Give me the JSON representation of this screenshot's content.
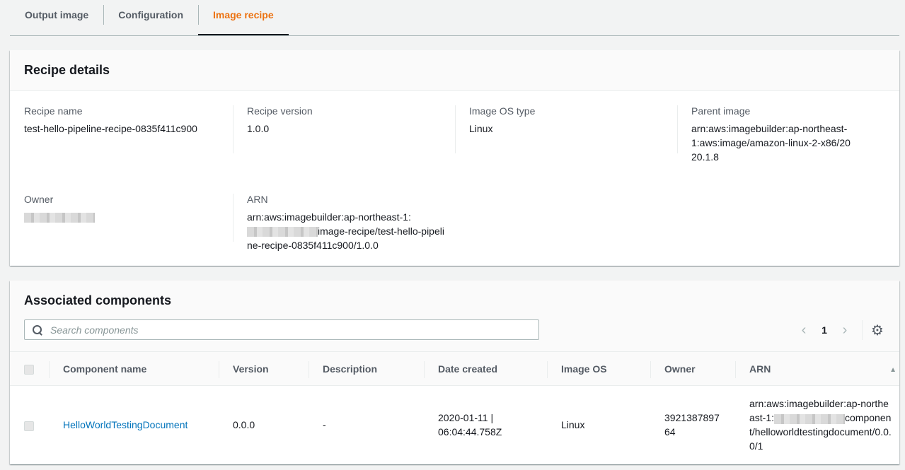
{
  "tabs": [
    {
      "label": "Output image",
      "active": false
    },
    {
      "label": "Configuration",
      "active": false
    },
    {
      "label": "Image recipe",
      "active": true
    }
  ],
  "colors": {
    "accent": "#ec7211",
    "link": "#0073bb"
  },
  "recipe_details": {
    "title": "Recipe details",
    "recipe_name": {
      "label": "Recipe name",
      "value": "test-hello-pipeline-recipe-0835f411c900"
    },
    "recipe_version": {
      "label": "Recipe version",
      "value": "1.0.0"
    },
    "image_os_type": {
      "label": "Image OS type",
      "value": "Linux"
    },
    "parent_image": {
      "label": "Parent image",
      "value": "arn:aws:imagebuilder:ap-northeast-1:aws:image/amazon-linux-2-x86/2020.1.8"
    },
    "owner": {
      "label": "Owner"
    },
    "arn": {
      "label": "ARN",
      "value_prefix": "arn:aws:imagebuilder:ap-northeast-1:",
      "value_suffix": "image-recipe/test-hello-pipeline-recipe-0835f411c900/1.0.0"
    }
  },
  "components": {
    "title": "Associated components",
    "search_placeholder": "Search components",
    "page": "1",
    "icons": {
      "search": "search-icon",
      "prev": "chevron-left-icon",
      "next": "chevron-right-icon",
      "settings": "gear-icon",
      "sort": "sort-ascending-icon"
    },
    "columns": [
      "Component name",
      "Version",
      "Description",
      "Date created",
      "Image OS",
      "Owner",
      "ARN"
    ],
    "rows": [
      {
        "name": "HelloWorldTestingDocument",
        "version": "0.0.0",
        "description": "-",
        "date_created": "2020-01-11 | 06:04:44.758Z",
        "image_os": "Linux",
        "owner": "392138789764",
        "arn_prefix": "arn:aws:imagebuilder:ap-northeast-1:",
        "arn_suffix": "component/helloworldtestingdocument/0.0.0/1"
      }
    ]
  }
}
